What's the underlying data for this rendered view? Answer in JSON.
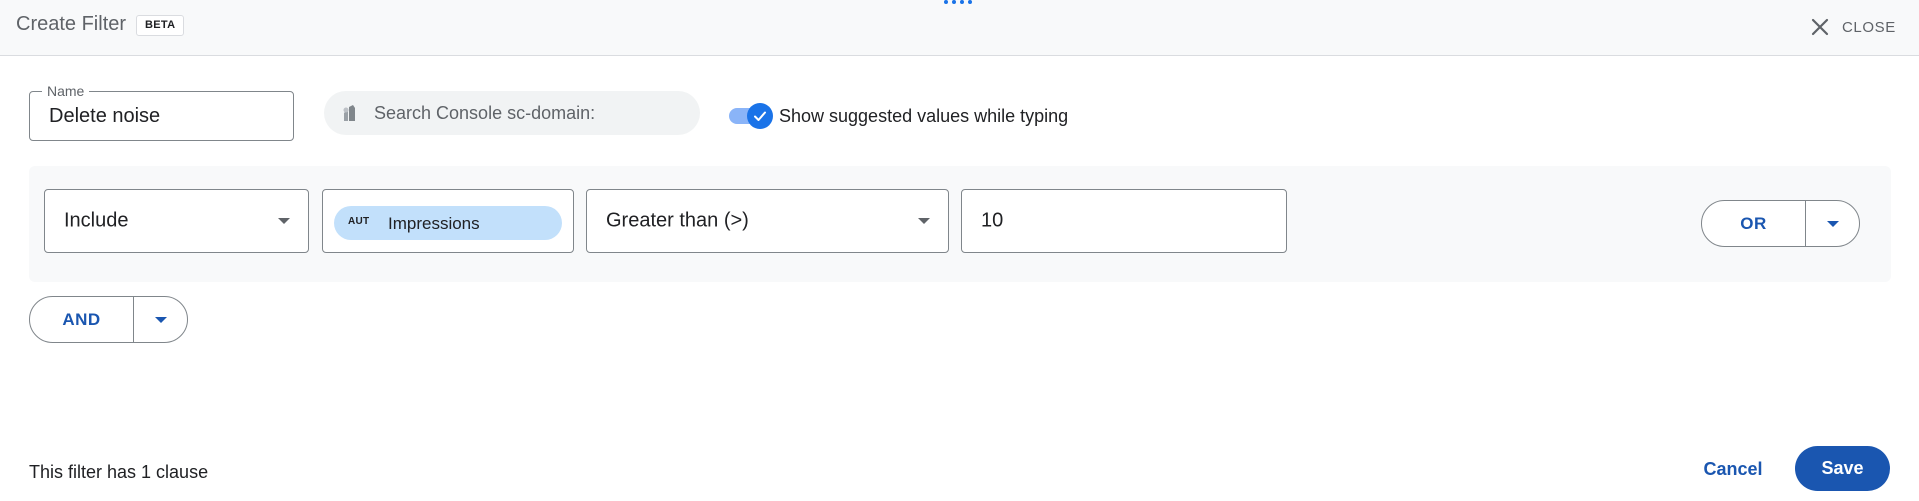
{
  "header": {
    "title": "Create Filter",
    "badge": "BETA",
    "close_label": "CLOSE"
  },
  "name_field": {
    "label": "Name",
    "value": "Delete noise"
  },
  "search_console": {
    "placeholder": "Search Console sc-domain:"
  },
  "suggest_toggle": {
    "label": "Show suggested values while typing",
    "checked": true
  },
  "clause": {
    "mode": "Include",
    "metric_chip_tag": "AUT",
    "metric": "Impressions",
    "operator": "Greater than (>)",
    "value": "10",
    "or_label": "OR"
  },
  "and_label": "AND",
  "footer": {
    "clause_count_text": "This filter has 1 clause",
    "cancel_label": "Cancel",
    "save_label": "Save"
  },
  "colors": {
    "accent": "#1a73e8",
    "primary_button": "#1a56b0",
    "chip_bg": "#c2e0fb"
  }
}
